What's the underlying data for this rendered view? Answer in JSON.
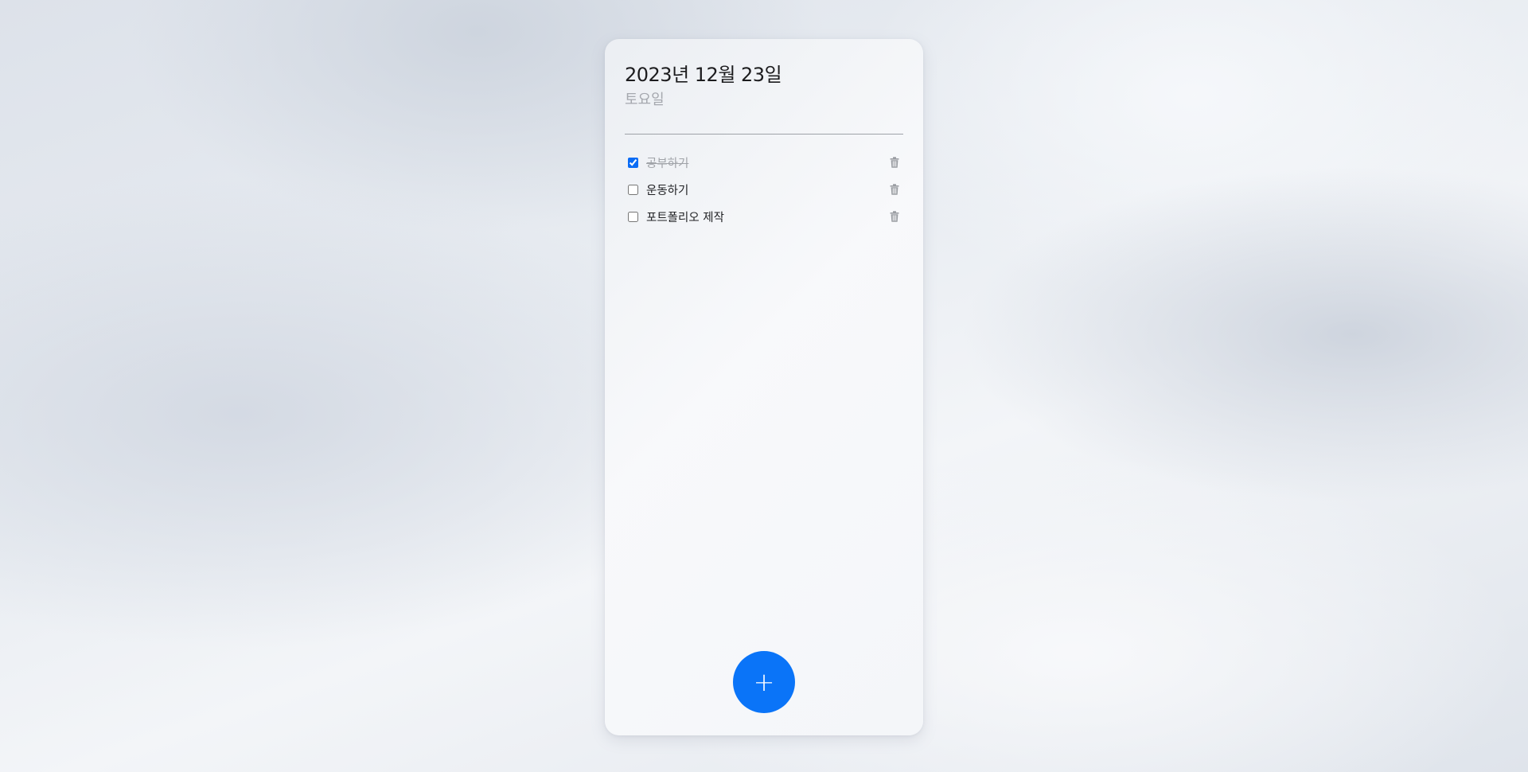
{
  "header": {
    "date": "2023년 12월 23일",
    "weekday": "토요일"
  },
  "todos": [
    {
      "text": "공부하기",
      "done": true
    },
    {
      "text": "운동하기",
      "done": false
    },
    {
      "text": "포트폴리오 제작",
      "done": false
    }
  ],
  "add_button": {
    "label": "+",
    "icon": "plus-icon"
  },
  "delete_icon": "trash-icon",
  "colors": {
    "accent": "#0a74f8",
    "muted_text": "#a0a3a8",
    "text": "#1f2023"
  }
}
